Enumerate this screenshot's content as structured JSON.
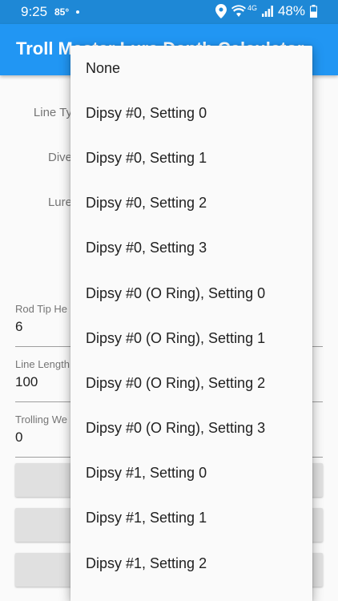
{
  "status_bar": {
    "time": "9:25",
    "temperature": "85°",
    "network": "4G",
    "battery": "48%"
  },
  "app_bar": {
    "title": "Troll Master Lure Depth Calculator"
  },
  "form": {
    "line_type_label": "Line Ty",
    "diver_label": "Dive",
    "lure_label": "Lure",
    "rod_tip_height": {
      "label": "Rod Tip He",
      "value": "6"
    },
    "line_length": {
      "label": "Line Length",
      "value": "100"
    },
    "trolling_weight": {
      "label": "Trolling We",
      "value": "0"
    }
  },
  "dropdown": {
    "items": [
      "None",
      "Dipsy #0, Setting 0",
      "Dipsy #0, Setting 1",
      "Dipsy #0, Setting 2",
      "Dipsy #0, Setting 3",
      "Dipsy #0 (O Ring), Setting 0",
      "Dipsy #0 (O Ring), Setting 1",
      "Dipsy #0 (O Ring), Setting 2",
      "Dipsy #0 (O Ring), Setting 3",
      "Dipsy #1, Setting 0",
      "Dipsy #1, Setting 1",
      "Dipsy #1, Setting 2"
    ]
  },
  "colors": {
    "app_bar": "#2196f3",
    "status_bar": "#1e88d6",
    "button": "#e0e0e0"
  }
}
